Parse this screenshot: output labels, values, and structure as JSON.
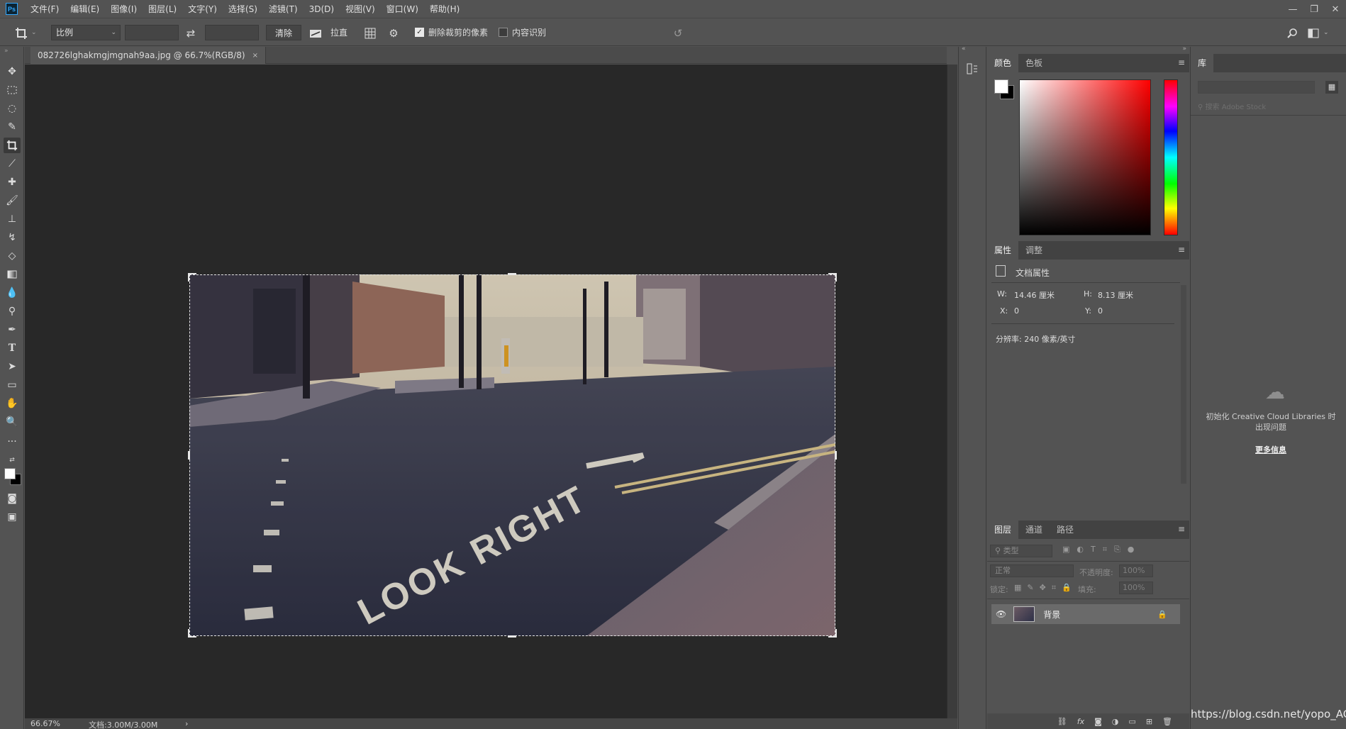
{
  "app": {
    "logo": "Ps"
  },
  "menu": [
    "文件(F)",
    "编辑(E)",
    "图像(I)",
    "图层(L)",
    "文字(Y)",
    "选择(S)",
    "滤镜(T)",
    "3D(D)",
    "视图(V)",
    "窗口(W)",
    "帮助(H)"
  ],
  "window_controls": {
    "minimize": "—",
    "restore": "❐",
    "close": "✕"
  },
  "options": {
    "ratio_select": "比例",
    "clear_button": "清除",
    "straighten_label": "拉直",
    "delete_cropped_label": "删除裁剪的像素",
    "delete_cropped_checked": true,
    "content_aware_label": "内容识别",
    "content_aware_checked": false
  },
  "document": {
    "tab_title": "082726lghakmgjmgnah9aa.jpg @ 66.7%(RGB/8)",
    "tab_close": "×",
    "zoom": "66.67%",
    "doc_size": "文档:3.00M/3.00M",
    "status_arrow": "›"
  },
  "color_panel": {
    "tabs": [
      "颜色",
      "色板"
    ],
    "active_tab": "颜色",
    "foreground": "#ffffff",
    "background": "#000000"
  },
  "properties_panel": {
    "tabs": [
      "属性",
      "调整"
    ],
    "active_tab": "属性",
    "section_title": "文档属性",
    "w_label": "W:",
    "w_value": "14.46 厘米",
    "h_label": "H:",
    "h_value": "8.13 厘米",
    "x_label": "X:",
    "x_value": "0",
    "y_label": "Y:",
    "y_value": "0",
    "resolution": "分辨率: 240 像素/英寸"
  },
  "layers_panel": {
    "tabs": [
      "图层",
      "通道",
      "路径"
    ],
    "active_tab": "图层",
    "filter_placeholder": "类型",
    "blend_mode": "正常",
    "opacity_label": "不透明度:",
    "opacity_value": "100%",
    "lock_label": "锁定:",
    "fill_label": "填充:",
    "fill_value": "100%",
    "layers": [
      {
        "name": "背景",
        "visible": true,
        "locked": true
      }
    ],
    "bottom_icons": [
      "link-icon",
      "fx-icon",
      "mask-icon",
      "adjustment-icon",
      "group-icon",
      "new-layer-icon",
      "trash-icon"
    ],
    "fx_label": "fx"
  },
  "library_panel": {
    "tab": "库",
    "search_placeholder": "搜索 Adobe Stock",
    "error_message": "初始化 Creative Cloud Libraries 时出现问题",
    "more_info": "更多信息"
  },
  "watermark": "https://blog.csdn.net/yopo_AG",
  "colors": {
    "app_bg": "#535353",
    "canvas_bg": "#282828",
    "panel_dark": "#424242"
  }
}
